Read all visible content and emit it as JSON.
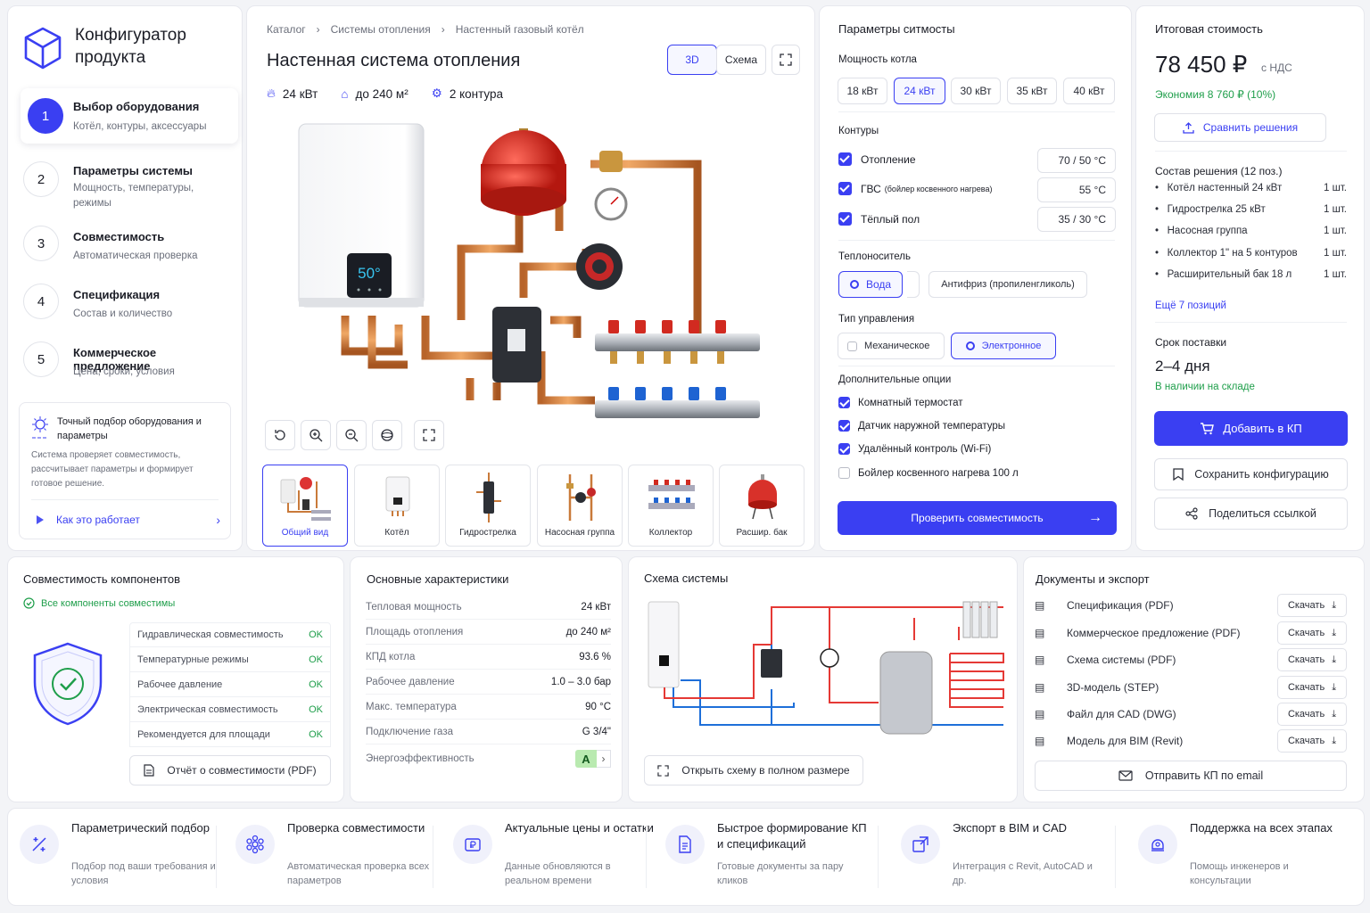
{
  "app": {
    "title": "Конфигуратор продукта"
  },
  "steps": [
    {
      "num": "1",
      "title": "Выбор оборудования",
      "sub": "Котёл, контуры, аксессуары"
    },
    {
      "num": "2",
      "title": "Параметры системы",
      "sub": "Мощность, температуры, режимы"
    },
    {
      "num": "3",
      "title": "Совместимость",
      "sub": "Автоматическая проверка"
    },
    {
      "num": "4",
      "title": "Спецификация",
      "sub": "Состав и количество"
    },
    {
      "num": "5",
      "title": "Коммерческое предложение",
      "sub": "Цена, сроки, условия"
    }
  ],
  "info": {
    "title": "Точный подбор оборудования и параметры",
    "text": "Система проверяет совместимость, рассчитывает параметры и формирует готовое решение.",
    "link": "Как это работает"
  },
  "breadcrumb": [
    "Каталог",
    "Системы отопления",
    "Настенный газовый котёл"
  ],
  "product": {
    "title": "Настенная система отопления",
    "power": "24 кВт",
    "area": "до 240 м²",
    "circuits": "2 контура",
    "display": "50°"
  },
  "view_toggle": {
    "a": "3D",
    "b": "Схема"
  },
  "thumbs": [
    "Общий вид",
    "Котёл",
    "Гидрострелка",
    "Насосная группа",
    "Коллектор",
    "Расшир. бак"
  ],
  "params": {
    "title": "Параметры ситмосты",
    "power_label": "Мощность котла",
    "power_options": [
      "18 кВт",
      "24 кВт",
      "30 кВт",
      "35 кВт",
      "40 кВт"
    ],
    "circuits_label": "Контуры",
    "circuits": [
      {
        "name": "Отопление",
        "note": "",
        "temp": "70 / 50 °C"
      },
      {
        "name": "ГВС",
        "note": "(бойлер косвенного нагрева)",
        "temp": "55 °C"
      },
      {
        "name": "Тёплый пол",
        "note": "",
        "temp": "35 / 30 °C"
      }
    ],
    "coolant_label": "Теплоноситель",
    "coolant": [
      "Вода",
      "Антифриз (пропиленгликоль)"
    ],
    "control_label": "Тип управления",
    "control": [
      "Механическое",
      "Электронное"
    ],
    "options_label": "Дополнительные опции",
    "options": [
      "Комнатный термостат",
      "Датчик наружной температуры",
      "Удалённый контроль (Wi-Fi)",
      "Бойлер косвенного нагрева 100 л"
    ],
    "check_button": "Проверить совместимость"
  },
  "summary": {
    "title": "Итоговая стоимость",
    "price": "78 450 ₽",
    "vat": "с НДС",
    "saving": "Экономия 8 760 ₽ (10%)",
    "compare": "Сравнить решения",
    "composition": "Состав решения (12 поз.)",
    "items": [
      {
        "name": "Котёл настенный 24 кВт",
        "qty": "1 шт."
      },
      {
        "name": "Гидрострелка 25 кВт",
        "qty": "1 шт."
      },
      {
        "name": "Насосная группа",
        "qty": "1 шт."
      },
      {
        "name": "Коллектор 1\" на 5 контуров",
        "qty": "1 шт."
      },
      {
        "name": "Расширительный бак 18 л",
        "qty": "1 шт."
      }
    ],
    "more": "Ещё 7 позиций",
    "delivery_label": "Срок поставки",
    "delivery": "2–4 дня",
    "stock": "В наличии на складе",
    "add": "Добавить в КП",
    "save": "Сохранить конфигурацию",
    "share": "Поделиться ссылкой"
  },
  "compat": {
    "title": "Совместимость компонентов",
    "status": "Все компоненты совместимы",
    "rows": [
      {
        "name": "Гидравлическая совместимость",
        "val": "OK"
      },
      {
        "name": "Температурные режимы",
        "val": "OK"
      },
      {
        "name": "Рабочее давление",
        "val": "OK"
      },
      {
        "name": "Электрическая совместимость",
        "val": "OK"
      },
      {
        "name": "Рекомендуется для площади",
        "val": "OK"
      }
    ],
    "report": "Отчёт о совместимости (PDF)"
  },
  "specs": {
    "title": "Основные характеристики",
    "rows": [
      {
        "k": "Тепловая мощность",
        "v": "24 кВт"
      },
      {
        "k": "Площадь отопления",
        "v": "до 240 м²"
      },
      {
        "k": "КПД котла",
        "v": "93.6 %"
      },
      {
        "k": "Рабочее давление",
        "v": "1.0 – 3.0 бар"
      },
      {
        "k": "Макс. температура",
        "v": "90 °C"
      },
      {
        "k": "Подключение газа",
        "v": "G 3/4\""
      }
    ],
    "energy_label": "Энергоэффективность",
    "energy_class": "A"
  },
  "scheme": {
    "title": "Схема системы",
    "open": "Открыть схему в полном размере"
  },
  "docs": {
    "title": "Документы и экспорт",
    "rows": [
      "Спецификация (PDF)",
      "Коммерческое предложение (PDF)",
      "Схема системы (PDF)",
      "3D-модель (STEP)",
      "Файл для CAD (DWG)",
      "Модель для BIM (Revit)"
    ],
    "download": "Скачать",
    "email": "Отправить КП по email"
  },
  "features": [
    {
      "t": "Параметрический подбор",
      "s": "Подбор под ваши требования и условия",
      "icon": "sliders-icon"
    },
    {
      "t": "Проверка совместимости",
      "s": "Автоматическая проверка всех параметров",
      "icon": "molecule-icon"
    },
    {
      "t": "Актуальные цены и остатки",
      "s": "Данные обновляются в реальном времени",
      "icon": "ruble-icon"
    },
    {
      "t": "Быстрое формирование КП и спецификаций",
      "s": "Готовые документы за пару кликов",
      "icon": "document-icon"
    },
    {
      "t": "Экспорт в BIM и CAD",
      "s": "Интеграция с Revit, AutoCAD и др.",
      "icon": "export-icon"
    },
    {
      "t": "Поддержка на всех этапах",
      "s": "Помощь инженеров и консультации",
      "icon": "support-icon"
    }
  ],
  "colors": {
    "accent": "#3a3ff2",
    "success": "#1e9e4a",
    "hot": "#e53935",
    "cold": "#1e6fd9"
  }
}
